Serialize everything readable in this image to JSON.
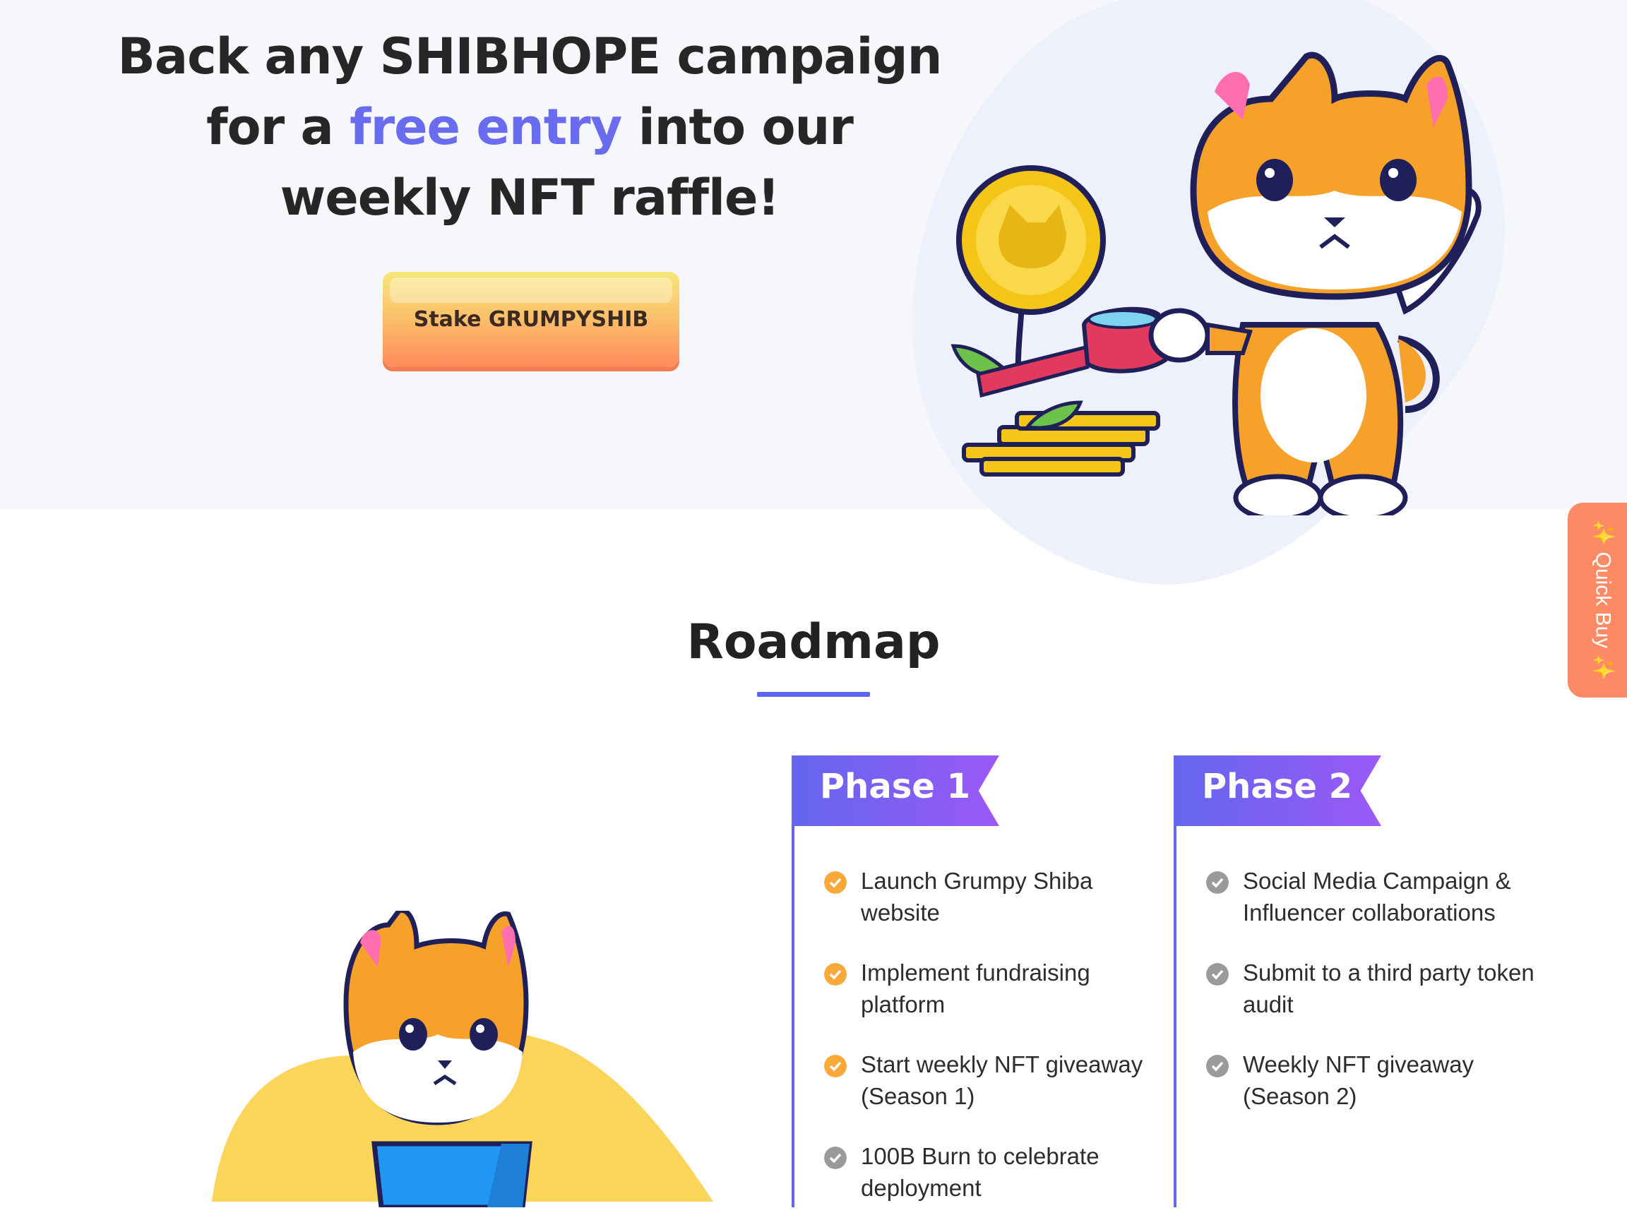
{
  "hero": {
    "title_part1": "Back any SHIBHOPE campaign for a ",
    "title_highlight": "free entry",
    "title_part2": " into our weekly NFT raffle!",
    "cta_label": "Stake GRUMPYSHIB"
  },
  "quick_buy": {
    "label": "✨ Quick Buy ✨"
  },
  "roadmap": {
    "title": "Roadmap",
    "phases": [
      {
        "label": "Phase 1",
        "items": [
          {
            "text": "Launch Grumpy Shiba website",
            "status": "done"
          },
          {
            "text": "Implement fundraising platform",
            "status": "done"
          },
          {
            "text": "Start weekly NFT giveaway (Season 1)",
            "status": "done"
          },
          {
            "text": "100B Burn to celebrate deployment",
            "status": "pending"
          }
        ]
      },
      {
        "label": "Phase 2",
        "items": [
          {
            "text": "Social Media Campaign & Influencer collaborations",
            "status": "pending"
          },
          {
            "text": "Submit to a third party token audit",
            "status": "pending"
          },
          {
            "text": "Weekly NFT giveaway (Season 2)",
            "status": "pending"
          }
        ]
      }
    ]
  },
  "colors": {
    "accent": "#6a6cf0",
    "done": "#f9a83a",
    "pending": "#9a9a9a",
    "quick_buy": "#ff8a66"
  }
}
